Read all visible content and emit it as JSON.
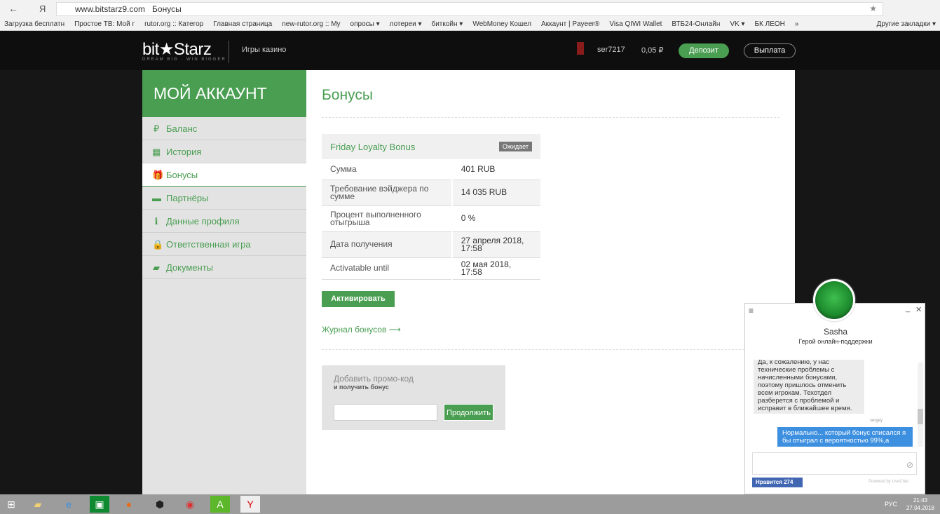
{
  "browser": {
    "url": "www.bitstarz9.com",
    "page_title": "Бонусы",
    "back": "←",
    "ya": "Я",
    "bookmarks": [
      "Загрузка бесплатн",
      "Простое ТВ: Мой г",
      "rutor.org :: Категор",
      "Главная страница",
      "new-rutor.org :: My",
      "опросы ▾",
      "лотереи ▾",
      "биткойн ▾",
      "WebMoney Кошел",
      "Аккаунт | Payeer®",
      "Visa QIWI Wallet",
      "ВТБ24-Онлайн",
      "VK ▾",
      "БК ЛЕОН",
      "»"
    ],
    "other_bookmarks": "Другие закладки ▾"
  },
  "header": {
    "logo": "bit★Starz",
    "tagline": "DREAM BIG · WIN BIGGER",
    "nav": "Игры казино",
    "username": "ser7217",
    "balance": "0,05 ₽",
    "deposit": "Депозит",
    "withdraw": "Выплата"
  },
  "sidebar": {
    "title": "МОЙ АККАУНТ",
    "items": [
      {
        "icon": "₽",
        "label": "Баланс"
      },
      {
        "icon": "▦",
        "label": "История"
      },
      {
        "icon": "🎁",
        "label": "Бонусы"
      },
      {
        "icon": "▬",
        "label": "Партнёры"
      },
      {
        "icon": "ℹ",
        "label": "Данные профиля"
      },
      {
        "icon": "🔒",
        "label": "Ответственная игра"
      },
      {
        "icon": "▰",
        "label": "Документы"
      }
    ]
  },
  "main": {
    "title": "Бонусы",
    "bonus": {
      "name": "Friday Loyalty Bonus",
      "status": "Ожидает",
      "rows": [
        [
          "Сумма",
          "401 RUB"
        ],
        [
          "Требование вэйджера по сумме",
          "14 035 RUB"
        ],
        [
          "Процент выполненного отыгрыша",
          "0 %"
        ],
        [
          "Дата получения",
          "27 апреля 2018, 17:58"
        ],
        [
          "Activatable until",
          "02 мая 2018, 17:58"
        ]
      ]
    },
    "activate": "Активировать",
    "log_link": "Журнал бонусов ⟶",
    "promo_title": "Добавить промо-код",
    "promo_sub": "и получить бонус",
    "promo_placeholder": "",
    "promo_button": "Продолжить"
  },
  "chat": {
    "agent": "Sasha",
    "role": "Герой онлайн-поддержки",
    "msg_agent": "Да, к сожалению, у нас технические проблемы с начисленными бонусами, поэтому пришлось отменить всем игрокам. Техотдел разберется с проблемой и исправит в ближайшее время.",
    "sender": "sergey",
    "msg_user": "Нормально... который бонус списался я бы отыграл с вероятностью 99%,а",
    "like": "Нравится 274",
    "powered": "Powered by LiveChat"
  },
  "taskbar": {
    "lang": "РУС",
    "time": "21:43",
    "date": "27.04.2018"
  }
}
